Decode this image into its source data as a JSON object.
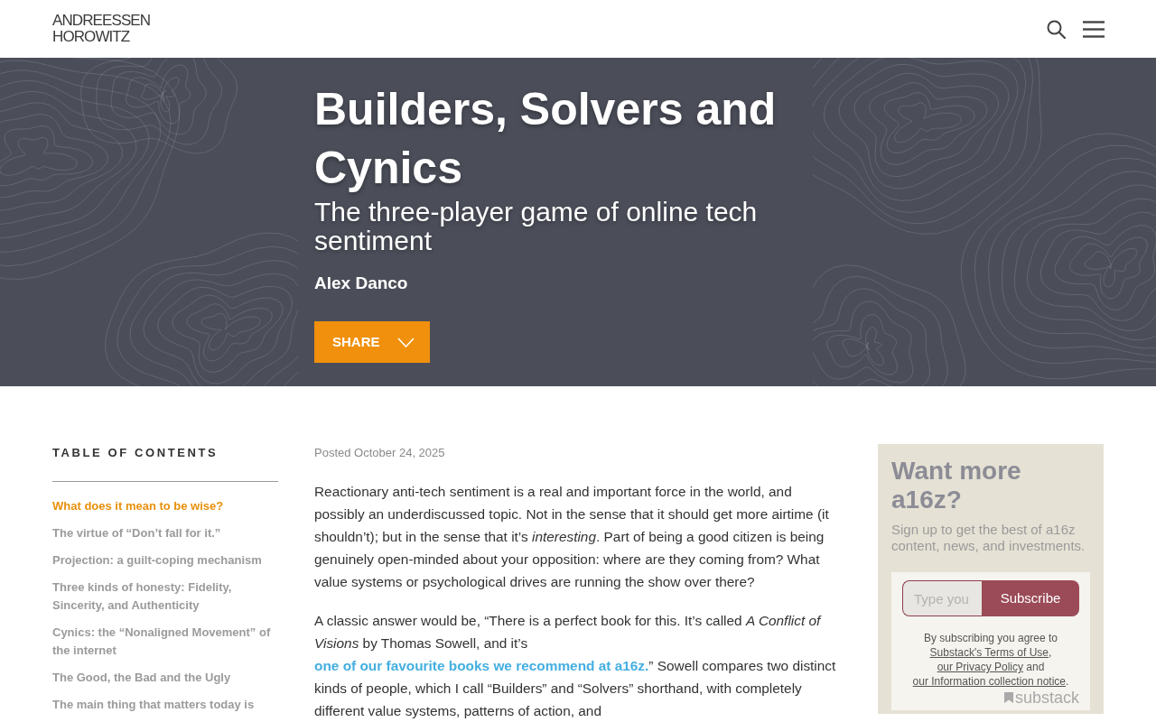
{
  "header": {
    "logo": [
      "ANDREESSEN",
      "HOROWITZ"
    ]
  },
  "hero": {
    "title": "Builders, Solvers and Cynics",
    "subtitle": "The three-player game of online tech sentiment",
    "author": "Alex Danco",
    "share_button": "SHARE"
  },
  "toc": {
    "heading": "TABLE OF CONTENTS",
    "items": [
      {
        "label": "What does it mean to be wise?",
        "selected": true
      },
      {
        "label": "The virtue of “Don’t fall for it.”",
        "selected": false
      },
      {
        "label": "Projection: a guilt-coping mechanism",
        "selected": false
      },
      {
        "label": "Three kinds of honesty: Fidelity, Sincerity, and Authenticity",
        "selected": false
      },
      {
        "label": "Cynics: the “Nonaligned Movement” of the internet",
        "selected": false
      },
      {
        "label": "The Good, the Bad and the Ugly",
        "selected": false
      },
      {
        "label": "The main thing that matters today is",
        "selected": false
      }
    ]
  },
  "article": {
    "posted": "Posted October 24, 2025",
    "paragraphs": [
      [
        {
          "kind": "text",
          "text": "Reactionary anti-tech sentiment is a real and important force in the world, and possibly an underdiscussed topic. Not in the sense that it should get more airtime (it shouldn’t); but in the sense that it’s *interesting*. Part of being a good citizen is being genuinely open-minded about your opposition: where are they coming from? What value systems or psychological drives are running the show over there?"
        }
      ],
      [
        {
          "kind": "text",
          "text": "A classic answer would be, “There is a perfect book for this. It’s called *A Conflict of Visions* by Thomas Sowell, and it’s "
        },
        {
          "kind": "link",
          "text": "one of our favourite books we recommend at a16z."
        },
        {
          "kind": "text",
          "text": "” Sowell compares two distinct kinds of people, which I call “Builders” and “Solvers” shorthand, with completely different value systems, patterns of action, and"
        }
      ]
    ]
  },
  "subscribe": {
    "title": "Want more a16z?",
    "description": "Sign up to get the best of a16z content, news, and investments.",
    "email_field": {
      "placeholder": "Type you"
    },
    "button": "Subscribe",
    "legal": [
      {
        "kind": "text",
        "text": "By subscribing you agree to "
      },
      {
        "kind": "link",
        "text": "Substack's Terms of Use"
      },
      {
        "kind": "text",
        "text": ", "
      },
      {
        "kind": "link",
        "text": "our Privacy Policy"
      },
      {
        "kind": "text",
        "text": " and "
      },
      {
        "kind": "link",
        "text": "our Information collection notice"
      },
      {
        "kind": "text",
        "text": "."
      }
    ],
    "brand": "substack"
  }
}
